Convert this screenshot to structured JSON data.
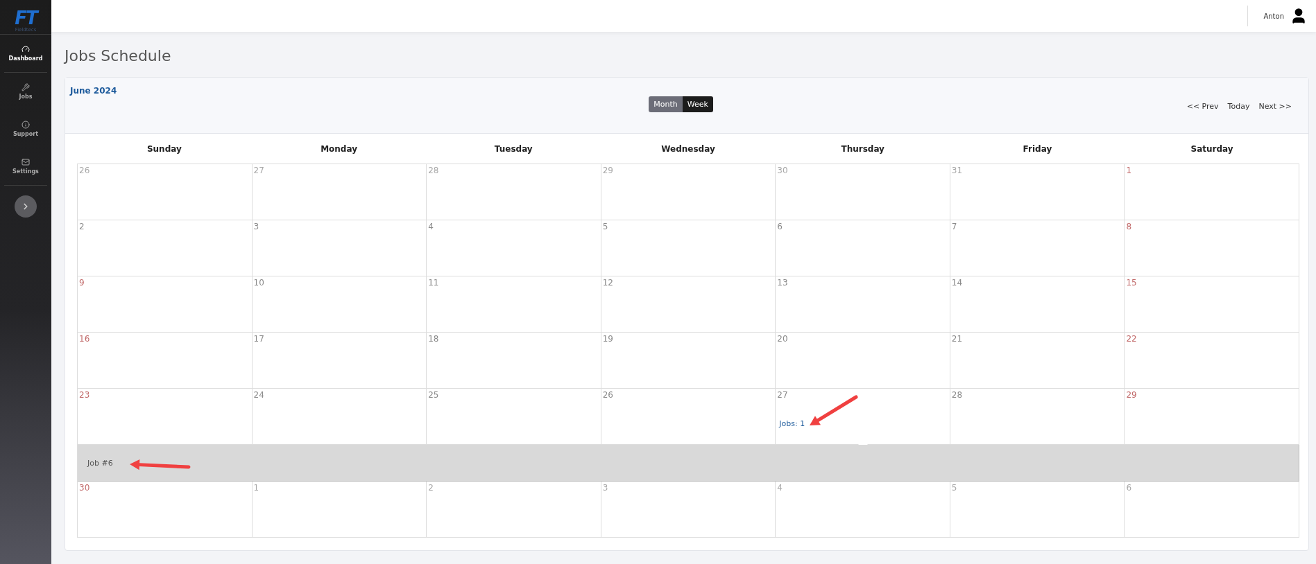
{
  "sidebar": {
    "logo": {
      "mark": "FT",
      "name": "Fieldtecs"
    },
    "items": [
      {
        "label": "Dashboard",
        "selected": true
      },
      {
        "label": "Jobs",
        "selected": false
      },
      {
        "label": "Support",
        "selected": false
      },
      {
        "label": "Settings",
        "selected": false
      }
    ]
  },
  "header": {
    "user": "Anton"
  },
  "page": {
    "title": "Jobs Schedule"
  },
  "calendar": {
    "month": "June 2024",
    "views": [
      {
        "label": "Month",
        "selected": true
      },
      {
        "label": "Week",
        "selected": false
      }
    ],
    "nav": [
      "<< Prev",
      "Today",
      "Next >>"
    ],
    "weekdays": [
      "Sunday",
      "Monday",
      "Tuesday",
      "Wednesday",
      "Thursday",
      "Friday",
      "Saturday"
    ],
    "weeks": [
      {
        "days": [
          {
            "date": "26",
            "kind": "other"
          },
          {
            "date": "27",
            "kind": "other"
          },
          {
            "date": "28",
            "kind": "other"
          },
          {
            "date": "29",
            "kind": "other"
          },
          {
            "date": "30",
            "kind": "other"
          },
          {
            "date": "31",
            "kind": "other"
          },
          {
            "date": "1",
            "kind": "weekend"
          }
        ]
      },
      {
        "days": [
          {
            "date": "2",
            "kind": "normal"
          },
          {
            "date": "3",
            "kind": "normal"
          },
          {
            "date": "4",
            "kind": "normal"
          },
          {
            "date": "5",
            "kind": "normal"
          },
          {
            "date": "6",
            "kind": "normal"
          },
          {
            "date": "7",
            "kind": "normal"
          },
          {
            "date": "8",
            "kind": "weekend"
          }
        ]
      },
      {
        "days": [
          {
            "date": "9",
            "kind": "weekend"
          },
          {
            "date": "10",
            "kind": "normal"
          },
          {
            "date": "11",
            "kind": "normal"
          },
          {
            "date": "12",
            "kind": "normal"
          },
          {
            "date": "13",
            "kind": "normal"
          },
          {
            "date": "14",
            "kind": "normal"
          },
          {
            "date": "15",
            "kind": "weekend"
          }
        ]
      },
      {
        "days": [
          {
            "date": "16",
            "kind": "weekend"
          },
          {
            "date": "17",
            "kind": "normal"
          },
          {
            "date": "18",
            "kind": "normal"
          },
          {
            "date": "19",
            "kind": "normal"
          },
          {
            "date": "20",
            "kind": "normal"
          },
          {
            "date": "21",
            "kind": "normal"
          },
          {
            "date": "22",
            "kind": "weekend"
          }
        ]
      },
      {
        "days": [
          {
            "date": "23",
            "kind": "weekend"
          },
          {
            "date": "24",
            "kind": "normal"
          },
          {
            "date": "25",
            "kind": "normal"
          },
          {
            "date": "26",
            "kind": "normal"
          },
          {
            "date": "27",
            "kind": "normal",
            "jobs": "Jobs: 1",
            "expanded": true
          },
          {
            "date": "28",
            "kind": "normal"
          },
          {
            "date": "29",
            "kind": "weekend"
          }
        ],
        "details": [
          "Job #6"
        ]
      },
      {
        "days": [
          {
            "date": "30",
            "kind": "weekend"
          },
          {
            "date": "1",
            "kind": "other"
          },
          {
            "date": "2",
            "kind": "other"
          },
          {
            "date": "3",
            "kind": "other"
          },
          {
            "date": "4",
            "kind": "other"
          },
          {
            "date": "5",
            "kind": "other"
          },
          {
            "date": "6",
            "kind": "other"
          }
        ]
      }
    ]
  }
}
